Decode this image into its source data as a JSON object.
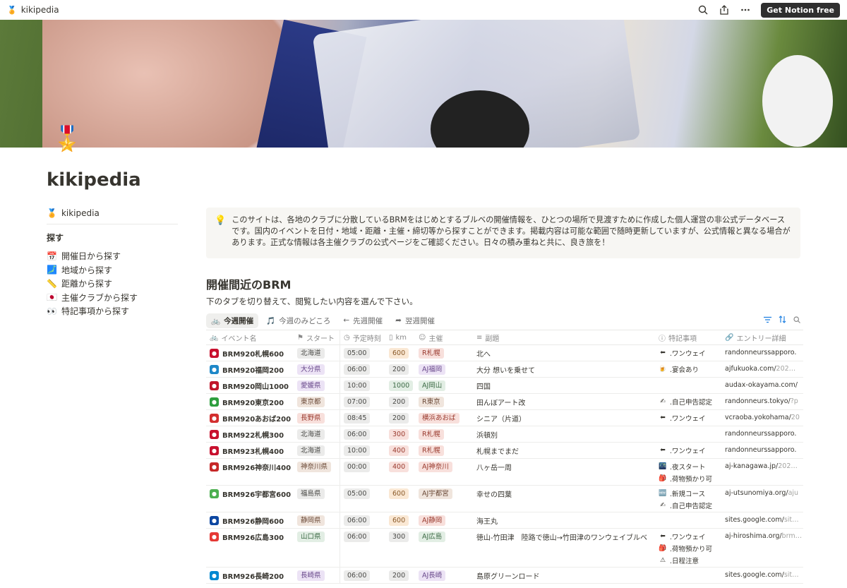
{
  "topbar": {
    "title": "kikipedia",
    "cta": "Get Notion free"
  },
  "page": {
    "title": "kikipedia"
  },
  "sidebar": {
    "home": "kikipedia",
    "section": "探す",
    "items": [
      {
        "icon": "📅",
        "label": "開催日から探す"
      },
      {
        "icon": "🗾",
        "label": "地域から探す"
      },
      {
        "icon": "📏",
        "label": "距離から探す"
      },
      {
        "icon": "🇯🇵",
        "label": "主催クラブから探す"
      },
      {
        "icon": "👀",
        "label": "特記事項から探す"
      }
    ]
  },
  "callout": {
    "icon": "💡",
    "text": "このサイトは、各地のクラブに分散しているBRMをはじめとするブルベの開催情報を、ひとつの場所で見渡すために作成した個人運営の非公式データベースです。国内のイベントを日付・地域・距離・主催・締切等から探すことができます。掲載内容は可能な範囲で随時更新していますが、公式情報と異なる場合があります。正式な情報は各主催クラブの公式ページをご確認ください。日々の積み重ねと共に、良き旅を！"
  },
  "section": {
    "heading": "開催間近のBRM",
    "subtitle": "下のタブを切り替えて、閲覧したい内容を選んで下さい。"
  },
  "tabs": [
    {
      "icon": "🚲",
      "label": "今週開催"
    },
    {
      "icon": "🎵",
      "label": "今週のみどころ"
    },
    {
      "icon": "←",
      "label": "先週開催"
    },
    {
      "icon": "➦",
      "label": "翌週開催"
    }
  ],
  "columns": [
    "イベント名",
    "スタート",
    "予定時刻",
    "km",
    "主催",
    "副題",
    "特記事項",
    "エントリー詳細"
  ],
  "rows": [
    {
      "name": "BRM920札幌600",
      "logo": "#c8102e",
      "start": "北海道",
      "start_c": "gray",
      "time": "05:00",
      "km": "600",
      "km_c": "orange",
      "org": "R札幌",
      "org_c": "red",
      "title": "北へ",
      "notes": [
        {
          "i": "⬅",
          "t": ".ワンウェイ"
        }
      ],
      "link": "randonneurssapporo.",
      "link_g": ""
    },
    {
      "name": "BRM920福岡200",
      "logo": "#1e88c8",
      "start": "大分県",
      "start_c": "purple",
      "time": "06:00",
      "km": "200",
      "km_c": "gray",
      "org": "AJ福岡",
      "org_c": "purple",
      "title": "大分 想いを乗せて",
      "notes": [
        {
          "i": "🍺",
          "t": ".宴会あり"
        }
      ],
      "link": "ajfukuoka.com/",
      "link_g": "202…"
    },
    {
      "name": "BRM920岡山1000",
      "logo": "#c0152a",
      "start": "愛媛県",
      "start_c": "purple",
      "time": "10:00",
      "km": "1000",
      "km_c": "green",
      "org": "AJ岡山",
      "org_c": "green",
      "title": "四国",
      "notes": [],
      "link": "audax-okayama.com/",
      "link_g": ""
    },
    {
      "name": "BRM920東京200",
      "logo": "#2e9e3e",
      "start": "東京都",
      "start_c": "brown",
      "time": "07:00",
      "km": "200",
      "km_c": "gray",
      "org": "R東京",
      "org_c": "brown",
      "title": "田んぼアート改",
      "notes": [
        {
          "i": "✍",
          "t": ".自己申告認定"
        }
      ],
      "link": "randonneurs.tokyo/",
      "link_g": "?p"
    },
    {
      "name": "BRM920あおば200",
      "logo": "#d32f2f",
      "start": "長野県",
      "start_c": "red",
      "time": "08:45",
      "km": "200",
      "km_c": "gray",
      "org": "横浜あおば",
      "org_c": "red",
      "title": "シニア（片道）",
      "notes": [
        {
          "i": "⬅",
          "t": ".ワンウェイ"
        }
      ],
      "link": "vcraoba.yokohama/",
      "link_g": "20"
    },
    {
      "name": "BRM922札幌300",
      "logo": "#c8102e",
      "start": "北海道",
      "start_c": "gray",
      "time": "06:00",
      "km": "300",
      "km_c": "red",
      "org": "R札幌",
      "org_c": "red",
      "title": "浜頓別",
      "notes": [],
      "link": "randonneurssapporo.",
      "link_g": ""
    },
    {
      "name": "BRM923札幌400",
      "logo": "#c8102e",
      "start": "北海道",
      "start_c": "gray",
      "time": "10:00",
      "km": "400",
      "km_c": "red",
      "org": "R札幌",
      "org_c": "red",
      "title": "札幌までまだ",
      "notes": [
        {
          "i": "⬅",
          "t": ".ワンウェイ"
        }
      ],
      "link": "randonneurssapporo.",
      "link_g": ""
    },
    {
      "name": "BRM926神奈川400",
      "logo": "#c62828",
      "start": "神奈川県",
      "start_c": "brown",
      "time": "00:00",
      "km": "400",
      "km_c": "red",
      "org": "AJ神奈川",
      "org_c": "red",
      "title": "八ヶ岳一周",
      "notes": [
        {
          "i": "🌃",
          "t": ".夜スタート"
        },
        {
          "i": "🎒",
          "t": ".荷物預かり可"
        }
      ],
      "link": "aj-kanagawa.jp/",
      "link_g": "202…"
    },
    {
      "name": "BRM926宇都宮600",
      "logo": "#4caf50",
      "start": "福島県",
      "start_c": "gray",
      "time": "05:00",
      "km": "600",
      "km_c": "orange",
      "org": "AJ宇都宮",
      "org_c": "brown",
      "title": "幸せの四葉",
      "notes": [
        {
          "i": "🆕",
          "t": ".新規コース"
        },
        {
          "i": "✍",
          "t": ".自己申告認定"
        }
      ],
      "link": "aj-utsunomiya.org/",
      "link_g": "aju"
    },
    {
      "name": "BRM926静岡600",
      "logo": "#0d47a1",
      "start": "静岡県",
      "start_c": "brown",
      "time": "06:00",
      "km": "600",
      "km_c": "orange",
      "org": "AJ静岡",
      "org_c": "red",
      "title": "海王丸",
      "notes": [],
      "link": "sites.google.com/",
      "link_g": "sit…"
    },
    {
      "name": "BRM926広島300",
      "logo": "#e53935",
      "start": "山口県",
      "start_c": "green",
      "time": "06:00",
      "km": "300",
      "km_c": "gray",
      "org": "AJ広島",
      "org_c": "green",
      "title": "徳山-竹田津　陸路で徳山→竹田津のワンウェイブルベ",
      "notes": [
        {
          "i": "⬅",
          "t": ".ワンウェイ"
        },
        {
          "i": "🎒",
          "t": ".荷物預かり可"
        },
        {
          "i": "⚠",
          "t": ".日程注意"
        }
      ],
      "link": "aj-hiroshima.org/",
      "link_g": "brm…"
    },
    {
      "name": "BRM926長崎200",
      "logo": "#0288d1",
      "start": "長崎県",
      "start_c": "purple",
      "time": "06:00",
      "km": "200",
      "km_c": "gray",
      "org": "AJ長崎",
      "org_c": "purple",
      "title": "島原グリーンロード",
      "notes": [],
      "link": "sites.google.com/",
      "link_g": "sit…"
    }
  ]
}
